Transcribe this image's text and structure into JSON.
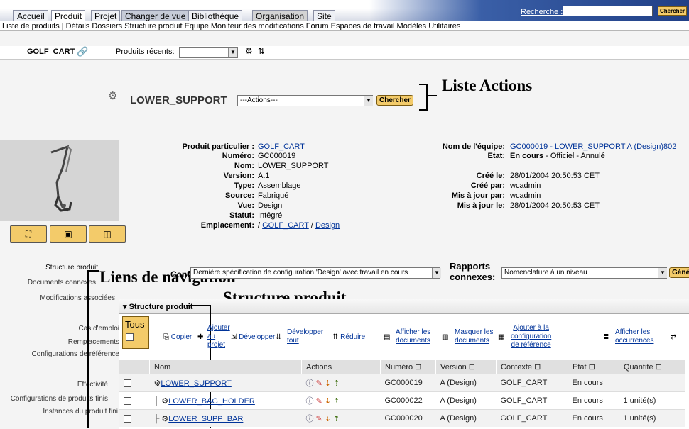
{
  "tabs": [
    "Accueil",
    "Produit",
    "Projet",
    "Changer de vue",
    "Bibliothèque",
    "Organisation",
    "Site"
  ],
  "search": {
    "link": "Recherche :",
    "button": "Chercher"
  },
  "subnav": "Liste de produits | Détails  Dossiers  Structure produit  Equipe  Moniteur des modifications  Forum  Espaces de travail  Modèles  Utilitaires",
  "recent": {
    "product_link": "GOLF_CART",
    "label": "Produits récents:"
  },
  "header": {
    "part_name": "LOWER_SUPPORT",
    "actions_select": "---Actions---",
    "chercher_button": "Chercher"
  },
  "annotations": {
    "liste_actions": "Liste Actions",
    "liens_navigation": "Liens de navigation",
    "structure_produit": "Structure produit"
  },
  "properties_left": [
    {
      "label": "Produit particulier :",
      "value": "GOLF_CART",
      "link": true
    },
    {
      "label": "Numéro:",
      "value": "GC000019"
    },
    {
      "label": "Nom:",
      "value": "LOWER_SUPPORT"
    },
    {
      "label": "Version:",
      "value": "A.1"
    },
    {
      "label": "Type:",
      "value": "Assemblage"
    },
    {
      "label": "Source:",
      "value": "Fabriqué"
    },
    {
      "label": "Vue:",
      "value": "Design"
    },
    {
      "label": "Statut:",
      "value": "Intégré"
    },
    {
      "label": "Emplacement:",
      "value_prefix": "/",
      "value": "GOLF_CART",
      "value_sep": "/",
      "value2": "Design"
    }
  ],
  "properties_right": [
    {
      "label": "Nom de l'équipe:",
      "value": "GC000019 - LOWER_SUPPORT A (Design)802",
      "link": true
    },
    {
      "label": "Etat:",
      "value_bold": "En cours",
      "value": " - Officiel - Annulé"
    },
    {
      "label": "Créé le:",
      "value": "28/01/2004 20:50:53 CET"
    },
    {
      "label": "Créé par:",
      "value": "wcadmin"
    },
    {
      "label": "Mis à jour par:",
      "value": "wcadmin"
    },
    {
      "label": "Mis à jour le:",
      "value": "28/01/2004 20:50:53 CET"
    }
  ],
  "nav_links": [
    "Structure produit",
    "Documents connexes",
    "Modifications associées",
    "Cas d'emploi",
    "Remplacements",
    "Configurations de référence",
    "Effectivité",
    "Configurations de produits finis",
    "Instances du produit fini"
  ],
  "config": {
    "label": "Configuration:",
    "value": "Dernière spécification de configuration 'Design' avec travail en cours",
    "rapports_label_1": "Rapports",
    "rapports_label_2": "connexes:",
    "rapports_value": "Nomenclature à un niveau",
    "generate_button": "Géné"
  },
  "structure": {
    "title": "Structure produit",
    "tous": "Tous",
    "toolbar": {
      "copier": "Copier",
      "ajouter_1": "Ajouter",
      "ajouter_2": "au",
      "ajouter_3": "projet",
      "developper": "Développer",
      "dev_tout_1": "Développer",
      "dev_tout_2": "tout",
      "reduire": "Réduire",
      "afficher_docs_1": "Afficher les",
      "afficher_docs_2": "documents",
      "masquer_docs_1": "Masquer les",
      "masquer_docs_2": "documents",
      "ajouter_conf_1": "Ajouter à la",
      "ajouter_conf_2": "configuration",
      "ajouter_conf_3": "de référence",
      "afficher_occ_1": "Afficher les",
      "afficher_occ_2": "occurrences"
    },
    "columns": [
      "Nom",
      "Actions",
      "Numéro ⊟",
      "Version ⊟",
      "Contexte ⊟",
      "Etat ⊟",
      "Quantité ⊟"
    ],
    "rows": [
      {
        "name": "LOWER_SUPPORT",
        "numero": "GC000019",
        "version": "A (Design)",
        "contexte": "GOLF_CART",
        "etat": "En cours",
        "quantite": ""
      },
      {
        "name": "LOWER_BAG_HOLDER",
        "numero": "GC000022",
        "version": "A (Design)",
        "contexte": "GOLF_CART",
        "etat": "En cours",
        "quantite": "1 unité(s)"
      },
      {
        "name": "LOWER_SUPP_BAR",
        "numero": "GC000020",
        "version": "A (Design)",
        "contexte": "GOLF_CART",
        "etat": "En cours",
        "quantite": "1 unité(s)"
      }
    ]
  }
}
